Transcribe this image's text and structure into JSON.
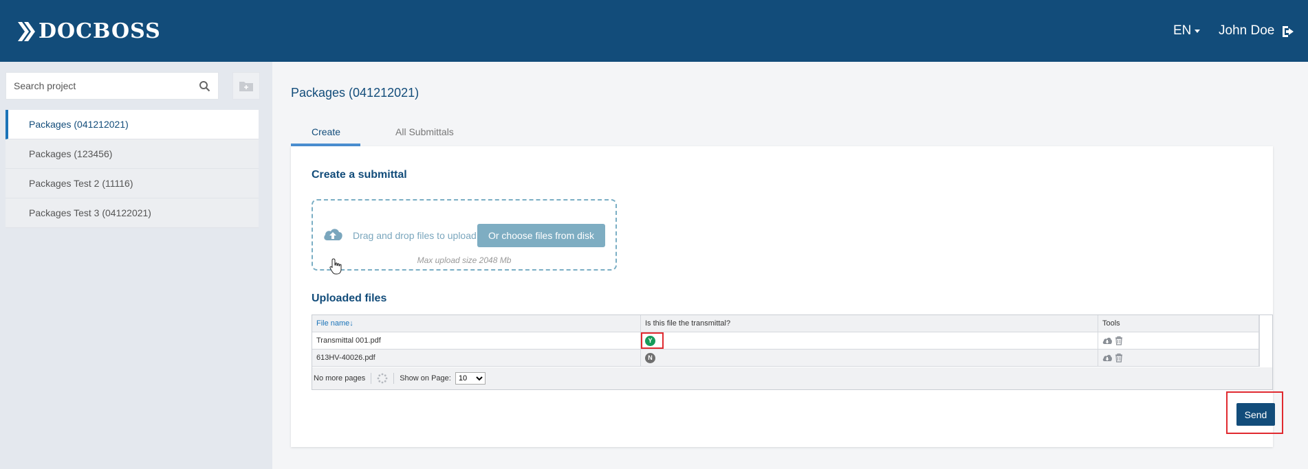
{
  "header": {
    "brand": "DOCBOSS",
    "language": "EN",
    "user_name": "John Doe",
    "logout_icon": "logout-icon"
  },
  "sidebar": {
    "search_placeholder": "Search project",
    "projects": [
      {
        "label": "Packages (041212021)",
        "active": true
      },
      {
        "label": "Packages (123456)",
        "active": false
      },
      {
        "label": "Packages Test 2 (11116)",
        "active": false
      },
      {
        "label": "Packages Test 3 (04122021)",
        "active": false
      }
    ]
  },
  "main": {
    "page_title": "Packages (041212021)",
    "tabs": [
      {
        "label": "Create",
        "active": true
      },
      {
        "label": "All Submittals",
        "active": false
      }
    ],
    "create_title": "Create a submittal",
    "upload": {
      "drag_text": "Drag and drop files to upload",
      "choose_button": "Or choose files from disk",
      "max_size": "Max upload size 2048 Mb"
    },
    "uploaded_title": "Uploaded files",
    "grid": {
      "columns": [
        "File name",
        "Is this file the transmittal?",
        "Tools"
      ],
      "sort_indicator": "↓",
      "rows": [
        {
          "file_name": "Transmittal 001.pdf",
          "transmittal": "Y"
        },
        {
          "file_name": "613HV-40026.pdf",
          "transmittal": "N"
        }
      ],
      "pager": {
        "status": "No more pages",
        "show_label": "Show on Page:",
        "page_size": "10"
      }
    },
    "send_button": "Send"
  },
  "colors": {
    "header_bg": "#124c7a",
    "accent": "#1a73b8",
    "yes_badge": "#159b5a",
    "no_badge": "#6f6f6f",
    "highlight": "#e0292f"
  }
}
